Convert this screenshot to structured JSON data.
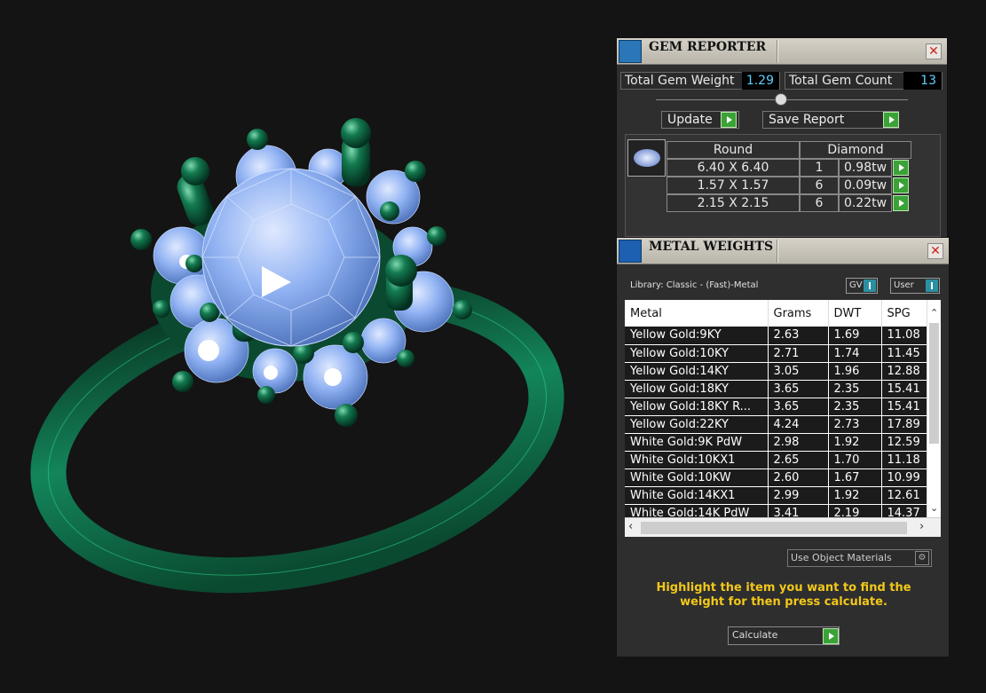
{
  "gem_reporter": {
    "title": "GEM REPORTER",
    "total_gem_weight_label": "Total Gem Weight",
    "total_gem_weight_value": "1.29",
    "total_gem_count_label": "Total Gem Count",
    "total_gem_count_value": "13",
    "update_label": "Update",
    "save_report_label": "Save Report",
    "gem_shape": "Round",
    "gem_material": "Diamond",
    "rows": [
      {
        "size": "6.40 X 6.40",
        "count": "1",
        "weight": "0.98tw"
      },
      {
        "size": "1.57 X 1.57",
        "count": "6",
        "weight": "0.09tw"
      },
      {
        "size": "2.15 X 2.15",
        "count": "6",
        "weight": "0.22tw"
      }
    ]
  },
  "metal_weights": {
    "title": "METAL WEIGHTS",
    "library_label": "Library: Classic - (Fast)-Metal",
    "gv_label": "GV",
    "user_label": "User",
    "columns": [
      "Metal",
      "Grams",
      "DWT",
      "SPG"
    ],
    "rows": [
      {
        "metal": "Yellow Gold:9KY",
        "grams": "2.63",
        "dwt": "1.69",
        "spg": "11.08"
      },
      {
        "metal": "Yellow Gold:10KY",
        "grams": "2.71",
        "dwt": "1.74",
        "spg": "11.45"
      },
      {
        "metal": "Yellow Gold:14KY",
        "grams": "3.05",
        "dwt": "1.96",
        "spg": "12.88"
      },
      {
        "metal": "Yellow Gold:18KY",
        "grams": "3.65",
        "dwt": "2.35",
        "spg": "15.41"
      },
      {
        "metal": "Yellow Gold:18KY R...",
        "grams": "3.65",
        "dwt": "2.35",
        "spg": "15.41"
      },
      {
        "metal": "Yellow Gold:22KY",
        "grams": "4.24",
        "dwt": "2.73",
        "spg": "17.89"
      },
      {
        "metal": "White Gold:9K PdW",
        "grams": "2.98",
        "dwt": "1.92",
        "spg": "12.59"
      },
      {
        "metal": "White Gold:10KX1",
        "grams": "2.65",
        "dwt": "1.70",
        "spg": "11.18"
      },
      {
        "metal": "White Gold:10KW",
        "grams": "2.60",
        "dwt": "1.67",
        "spg": "10.99"
      },
      {
        "metal": "White Gold:14KX1",
        "grams": "2.99",
        "dwt": "1.92",
        "spg": "12.61"
      },
      {
        "metal": "White Gold:14K PdW",
        "grams": "3.41",
        "dwt": "2.19",
        "spg": "14.37"
      }
    ],
    "use_object_materials_label": "Use Object Materials",
    "instruction": "Highlight the item you want to find the weight for then press calculate.",
    "calculate_label": "Calculate"
  },
  "colors": {
    "metal_green": "#0f6a45",
    "gem_blue": "#8fb1f2",
    "accent_yellow": "#f2c81a",
    "value_cyan": "#5fd0ff",
    "button_green": "#3aa236"
  },
  "icons": [
    "gem-reporter-icon",
    "metal-weights-icon",
    "close-icon",
    "play-icon",
    "gem-thumbnail-icon",
    "scroll-up-icon",
    "scroll-down-icon",
    "scroll-left-icon",
    "scroll-right-icon",
    "toggle-icon"
  ]
}
